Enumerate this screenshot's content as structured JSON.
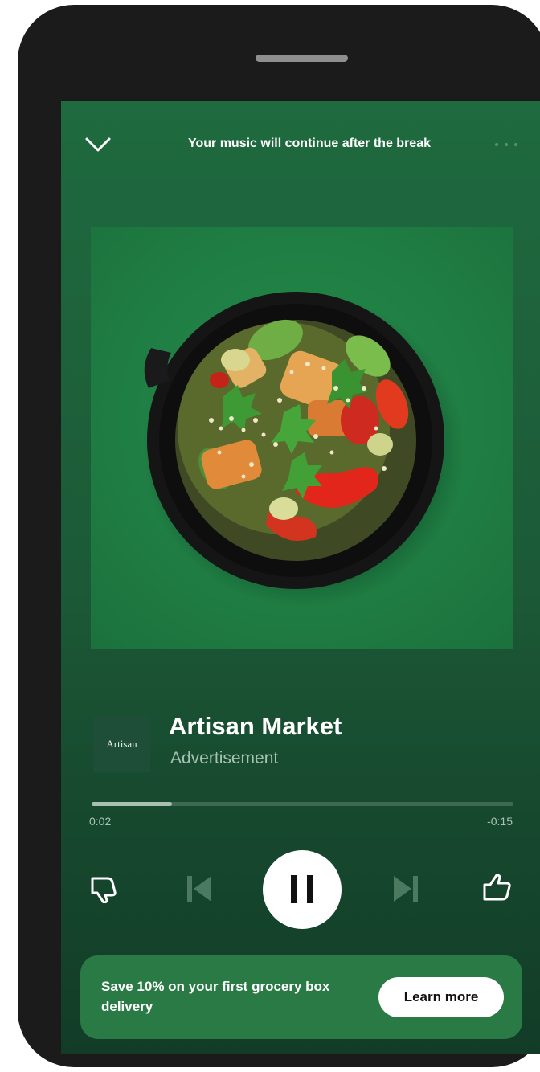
{
  "header": {
    "message": "Your music will continue after the break",
    "collapse_icon": "chevron-down-icon",
    "more_icon": "more-horizontal-icon"
  },
  "artwork": {
    "subject": "salad-bowl"
  },
  "track": {
    "logo_text": "Artisan",
    "title": "Artisan Market",
    "subtitle": "Advertisement"
  },
  "progress": {
    "elapsed": "0:02",
    "remaining": "-0:15",
    "fraction": 0.19
  },
  "controls": {
    "dislike_icon": "thumbs-down-icon",
    "prev_icon": "skip-previous-icon",
    "play_icon": "pause-icon",
    "next_icon": "skip-next-icon",
    "like_icon": "thumbs-up-icon"
  },
  "banner": {
    "text": "Save 10% on your first grocery box delivery",
    "button_label": "Learn more"
  },
  "colors": {
    "background": "#1f6a3f",
    "artwork": "#1f7d43",
    "banner": "#2a7a46",
    "accent": "#ffffff"
  }
}
